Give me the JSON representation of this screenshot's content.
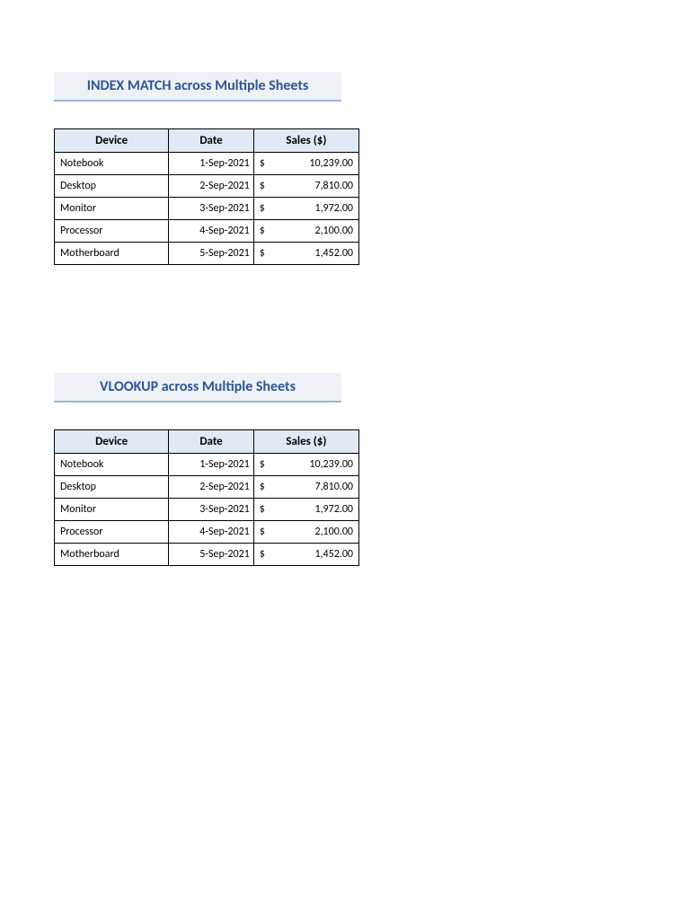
{
  "section1": {
    "title": "INDEX MATCH across Multiple Sheets",
    "headers": {
      "device": "Device",
      "date": "Date",
      "sales": "Sales ($)"
    },
    "currency": "$",
    "rows": [
      {
        "device": "Notebook",
        "date": "1-Sep-2021",
        "sales": "10,239.00"
      },
      {
        "device": "Desktop",
        "date": "2-Sep-2021",
        "sales": "7,810.00"
      },
      {
        "device": "Monitor",
        "date": "3-Sep-2021",
        "sales": "1,972.00"
      },
      {
        "device": "Processor",
        "date": "4-Sep-2021",
        "sales": "2,100.00"
      },
      {
        "device": "Motherboard",
        "date": "5-Sep-2021",
        "sales": "1,452.00"
      }
    ]
  },
  "section2": {
    "title": "VLOOKUP across Multiple Sheets",
    "headers": {
      "device": "Device",
      "date": "Date",
      "sales": "Sales ($)"
    },
    "currency": "$",
    "rows": [
      {
        "device": "Notebook",
        "date": "1-Sep-2021",
        "sales": "10,239.00"
      },
      {
        "device": "Desktop",
        "date": "2-Sep-2021",
        "sales": "7,810.00"
      },
      {
        "device": "Monitor",
        "date": "3-Sep-2021",
        "sales": "1,972.00"
      },
      {
        "device": "Processor",
        "date": "4-Sep-2021",
        "sales": "2,100.00"
      },
      {
        "device": "Motherboard",
        "date": "5-Sep-2021",
        "sales": "1,452.00"
      }
    ]
  }
}
